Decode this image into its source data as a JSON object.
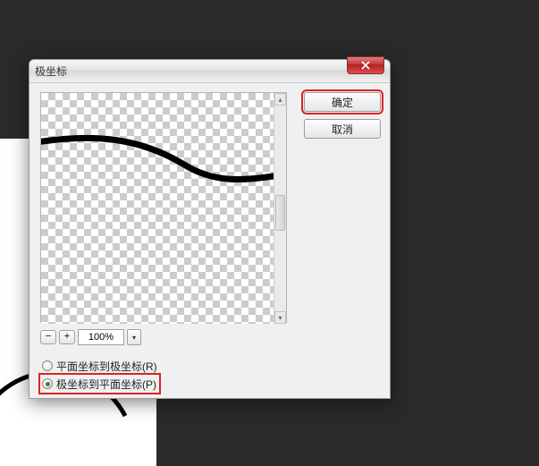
{
  "dialog": {
    "title": "极坐标"
  },
  "buttons": {
    "ok": "确定",
    "cancel": "取消"
  },
  "zoom": {
    "minus": "−",
    "plus": "+",
    "value": "100%",
    "chevron": "▾"
  },
  "options": {
    "rect_to_polar": "平面坐标到极坐标(R)",
    "polar_to_rect": "极坐标到平面坐标(P)",
    "selected": "polar_to_rect"
  },
  "scroll": {
    "up": "▴",
    "down": "▾"
  }
}
